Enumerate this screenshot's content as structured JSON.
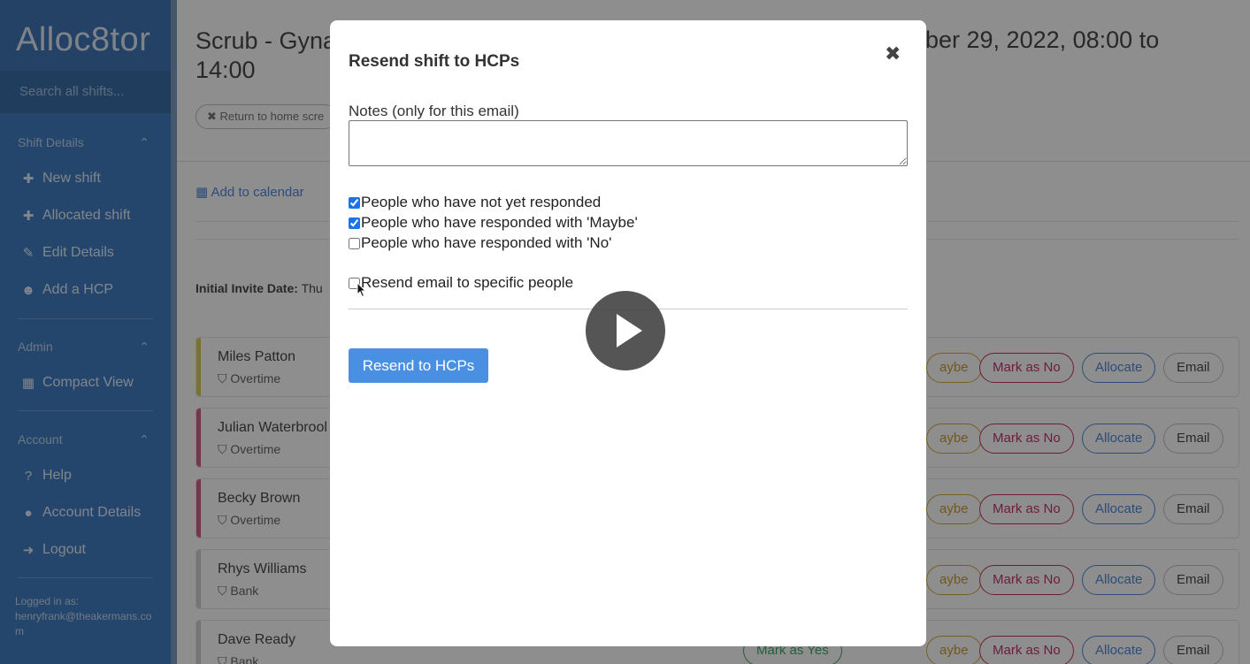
{
  "sidebar": {
    "logo": "Alloc8tor",
    "search_placeholder": "Search all shifts...",
    "sections": [
      {
        "title": "Shift Details",
        "items": [
          {
            "icon": "plus-icon",
            "label": "New shift"
          },
          {
            "icon": "plus-icon",
            "label": "Allocated shift"
          },
          {
            "icon": "edit-icon",
            "label": "Edit Details"
          },
          {
            "icon": "user-plus-icon",
            "label": "Add a HCP"
          }
        ]
      },
      {
        "title": "Admin",
        "items": [
          {
            "icon": "grid-icon",
            "label": "Compact View"
          }
        ]
      },
      {
        "title": "Account",
        "items": [
          {
            "icon": "help-icon",
            "label": "Help"
          },
          {
            "icon": "user-icon",
            "label": "Account Details"
          },
          {
            "icon": "logout-icon",
            "label": "Logout"
          }
        ]
      }
    ],
    "logged_in_label": "Logged in as:",
    "logged_in_email": "henryfrank@theakermans.com"
  },
  "page": {
    "title_left": "Scrub - Gyna",
    "title_line2": "14:00",
    "title_right": "ber 29, 2022, 08:00 to",
    "return_label": "✖ Return to home scre",
    "add_to_calendar": "Add to calendar",
    "initial_invite_label": "Initial Invite Date:",
    "initial_invite_value": "Thu"
  },
  "hcps": [
    {
      "name": "Miles Patton",
      "tag": "Overtime",
      "color": "#d8c640"
    },
    {
      "name": "Julian Waterbrool",
      "tag": "Overtime",
      "color": "#d04a7a"
    },
    {
      "name": "Becky Brown",
      "tag": "Overtime",
      "color": "#d04a7a"
    },
    {
      "name": "Rhys Williams",
      "tag": "Bank",
      "color": "#cccccc"
    },
    {
      "name": "Dave Ready",
      "tag": "Bank",
      "color": "#cccccc"
    }
  ],
  "hcp_buttons": {
    "maybe": "aybe",
    "no": "Mark as No",
    "allocate": "Allocate",
    "email": "Email",
    "yes": "Mark as Yes"
  },
  "modal": {
    "title": "Resend shift to HCPs",
    "close": "✖",
    "notes_label": "Notes (only for this email)",
    "notes_value": "",
    "checkboxes": [
      {
        "label": "People who have not yet responded",
        "checked": true
      },
      {
        "label": "People who have responded with 'Maybe'",
        "checked": true
      },
      {
        "label": "People who have responded with 'No'",
        "checked": false
      }
    ],
    "specific": {
      "label": "Resend email to specific people",
      "checked": false
    },
    "submit_label": "Resend to HCPs"
  },
  "colors": {
    "sidebar": "#2c6fbb",
    "primary_button": "#4a90e2",
    "no_button": "#c2185b",
    "allocate_button": "#3a7bd5"
  }
}
